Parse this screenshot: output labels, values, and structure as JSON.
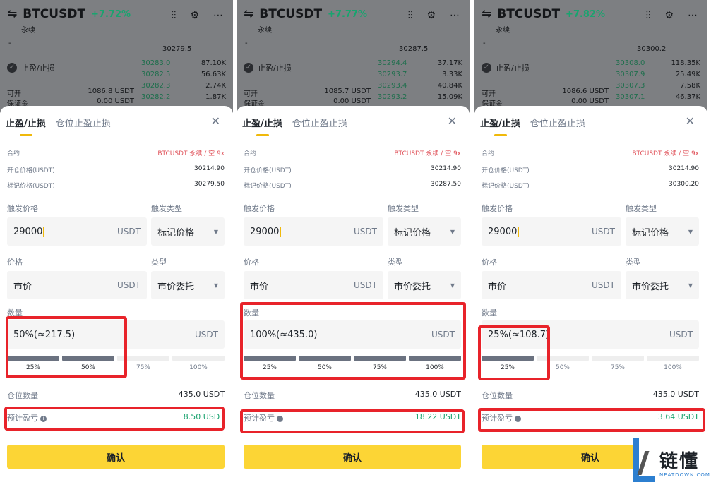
{
  "panels": [
    {
      "symbol": "BTCUSDT",
      "change": "+7.72%",
      "perp": "永续",
      "dash": "-",
      "mid_price": "30279.5",
      "tpsl_label": "止盈/止损",
      "open_label": "可开",
      "open_val": "1086.8 USDT",
      "margin_label": "保证金",
      "margin_val": "0.00 USDT",
      "ob": [
        [
          "30283.0",
          "87.10K"
        ],
        [
          "30282.5",
          "56.63K"
        ],
        [
          "30282.3",
          "2.74K"
        ],
        [
          "30282.2",
          "1.87K"
        ]
      ],
      "tabs": [
        "止盈/止损",
        "仓位止盈止损"
      ],
      "contract_label": "合约",
      "contract_val": "BTCUSDT 永续 / 空 9x",
      "entry_label": "开仓价格(USDT)",
      "entry_val": "30214.90",
      "mark_label": "标记价格(USDT)",
      "mark_val": "30279.50",
      "trigger_label": "触发价格",
      "trigger_val": "29000",
      "trigger_unit": "USDT",
      "trigger_type_label": "触发类型",
      "trigger_type_val": "标记价格",
      "price_label": "价格",
      "price_val": "市价",
      "price_unit": "USDT",
      "type_label": "类型",
      "type_val": "市价委托",
      "qty_label": "数量",
      "qty_val": "50%(≈217.5)",
      "qty_unit": "USDT",
      "slider": [
        "25%",
        "50%",
        "75%",
        "100%"
      ],
      "slider_level": 0.5,
      "pos_label": "仓位数量",
      "pos_val": "435.0 USDT",
      "pnl_label": "预计盈亏",
      "pnl_val": "8.50 USDT",
      "confirm": "确认"
    },
    {
      "symbol": "BTCUSDT",
      "change": "+7.77%",
      "perp": "永续",
      "dash": "-",
      "mid_price": "30287.5",
      "tpsl_label": "止盈/止损",
      "open_label": "可开",
      "open_val": "1085.7 USDT",
      "margin_label": "保证金",
      "margin_val": "0.00 USDT",
      "ob": [
        [
          "30294.4",
          "37.17K"
        ],
        [
          "30293.7",
          "3.33K"
        ],
        [
          "30293.4",
          "40.84K"
        ],
        [
          "30293.2",
          "15.09K"
        ]
      ],
      "tabs": [
        "止盈/止损",
        "仓位止盈止损"
      ],
      "contract_label": "合约",
      "contract_val": "BTCUSDT 永续 / 空 9x",
      "entry_label": "开仓价格(USDT)",
      "entry_val": "30214.90",
      "mark_label": "标记价格(USDT)",
      "mark_val": "30287.50",
      "trigger_label": "触发价格",
      "trigger_val": "29000",
      "trigger_unit": "USDT",
      "trigger_type_label": "触发类型",
      "trigger_type_val": "标记价格",
      "price_label": "价格",
      "price_val": "市价",
      "price_unit": "USDT",
      "type_label": "类型",
      "type_val": "市价委托",
      "qty_label": "数量",
      "qty_val": "100%(≈435.0)",
      "qty_unit": "USDT",
      "slider": [
        "25%",
        "50%",
        "75%",
        "100%"
      ],
      "slider_level": 1.0,
      "pos_label": "仓位数量",
      "pos_val": "435.0 USDT",
      "pnl_label": "预计盈亏",
      "pnl_val": "18.22 USDT",
      "confirm": "确认"
    },
    {
      "symbol": "BTCUSDT",
      "change": "+7.82%",
      "perp": "永续",
      "dash": "-",
      "mid_price": "30300.2",
      "tpsl_label": "止盈/止损",
      "open_label": "可开",
      "open_val": "1086.6 USDT",
      "margin_label": "保证金",
      "margin_val": "0.00 USDT",
      "ob": [
        [
          "30308.0",
          "118.35K"
        ],
        [
          "30307.9",
          "25.49K"
        ],
        [
          "30307.3",
          "7.58K"
        ],
        [
          "30307.1",
          "46.37K"
        ]
      ],
      "tabs": [
        "止盈/止损",
        "仓位止盈止损"
      ],
      "contract_label": "合约",
      "contract_val": "BTCUSDT 永续 / 空 9x",
      "entry_label": "开仓价格(USDT)",
      "entry_val": "30214.90",
      "mark_label": "标记价格(USDT)",
      "mark_val": "30300.20",
      "trigger_label": "触发价格",
      "trigger_val": "29000",
      "trigger_unit": "USDT",
      "trigger_type_label": "触发类型",
      "trigger_type_val": "标记价格",
      "price_label": "价格",
      "price_val": "市价",
      "price_unit": "USDT",
      "type_label": "类型",
      "type_val": "市价委托",
      "qty_label": "数量",
      "qty_val": "25%(≈108.7)",
      "qty_unit": "USDT",
      "slider": [
        "25%",
        "50%",
        "75%",
        "100%"
      ],
      "slider_level": 0.25,
      "pos_label": "仓位数量",
      "pos_val": "435.0 USDT",
      "pnl_label": "预计盈亏",
      "pnl_val": "3.64 USDT",
      "confirm": "确认"
    }
  ],
  "colors": {
    "accent": "#fcd535",
    "profit": "#1aa36f",
    "highlight": "#e8232a",
    "short": "#e0535b"
  },
  "watermark": {
    "text": "链懂",
    "sub": "NEATDOWN.COM"
  }
}
